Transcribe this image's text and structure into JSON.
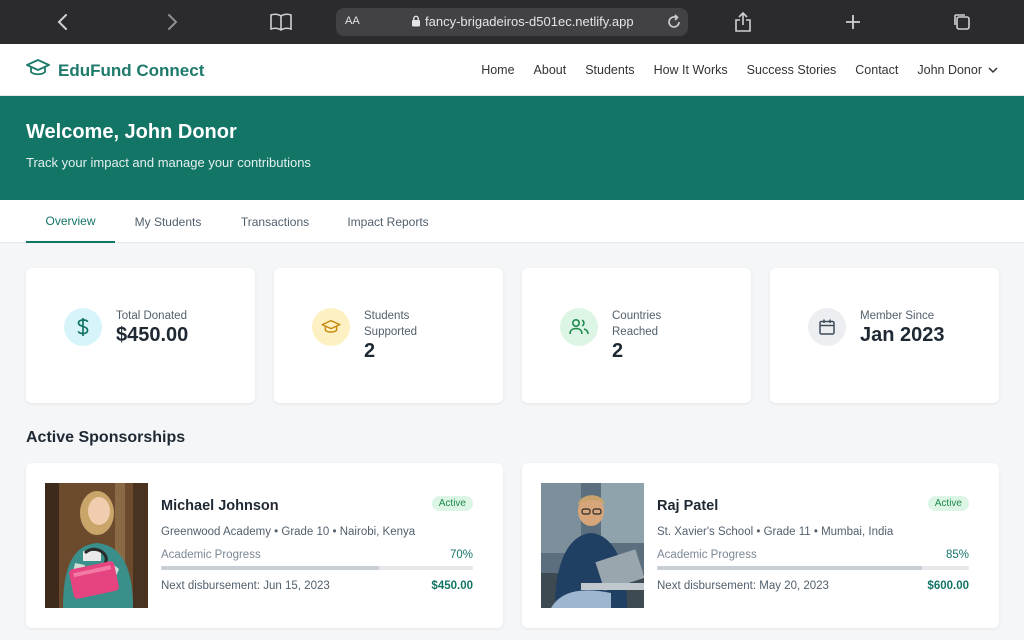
{
  "browser": {
    "text_size_label": "AA",
    "url": "fancy-brigadeiros-d501ec.netlify.app"
  },
  "navbar": {
    "brand": "EduFund Connect",
    "links": [
      "Home",
      "About",
      "Students",
      "How It Works",
      "Success Stories",
      "Contact"
    ],
    "user": "John Donor"
  },
  "hero": {
    "title": "Welcome, John Donor",
    "subtitle": "Track your impact and manage your contributions"
  },
  "tabs": [
    "Overview",
    "My Students",
    "Transactions",
    "Impact Reports"
  ],
  "active_tab": "Overview",
  "stats": [
    {
      "label": "Total Donated",
      "value": "$450.00",
      "icon": "dollar-icon"
    },
    {
      "label": "Students Supported",
      "value": "2",
      "icon": "graduation-cap-icon"
    },
    {
      "label": "Countries Reached",
      "value": "2",
      "icon": "users-icon"
    },
    {
      "label": "Member Since",
      "value": "Jan 2023",
      "icon": "calendar-icon"
    }
  ],
  "sponsorships_title": "Active Sponsorships",
  "sponsorships": [
    {
      "name": "Michael Johnson",
      "status": "Active",
      "details": "Greenwood Academy • Grade 10 • Nairobi, Kenya",
      "progress_label": "Academic Progress",
      "progress": "70%",
      "progress_fraction": 0.7,
      "next_disbursement": "Next disbursement: Jun 15, 2023",
      "amount": "$450.00"
    },
    {
      "name": "Raj Patel",
      "status": "Active",
      "details": "St. Xavier's School • Grade 11 • Mumbai, India",
      "progress_label": "Academic Progress",
      "progress": "85%",
      "progress_fraction": 0.85,
      "next_disbursement": "Next disbursement: May 20, 2023",
      "amount": "$600.00"
    }
  ],
  "colors": {
    "brand": "#137566",
    "badge_bg": "#dcf5e4",
    "badge_text": "#1f8a4c"
  }
}
